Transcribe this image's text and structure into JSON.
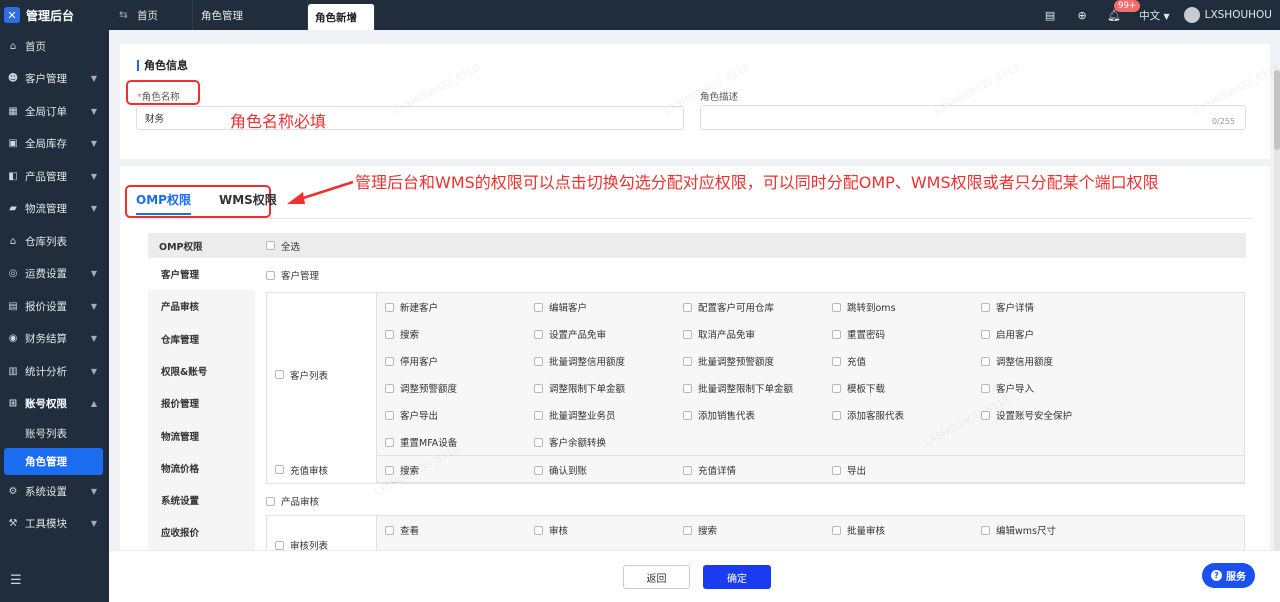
{
  "app": {
    "title": "管理后台"
  },
  "sidebar": {
    "items": [
      {
        "label": "首页",
        "icon": "home-icon",
        "chevron": false
      },
      {
        "label": "客户管理",
        "icon": "users-icon",
        "chevron": true
      },
      {
        "label": "全局订单",
        "icon": "order-icon",
        "chevron": true
      },
      {
        "label": "全局库存",
        "icon": "stock-icon",
        "chevron": true
      },
      {
        "label": "产品管理",
        "icon": "product-icon",
        "chevron": true
      },
      {
        "label": "物流管理",
        "icon": "truck-icon",
        "chevron": true
      },
      {
        "label": "仓库列表",
        "icon": "warehouse-icon",
        "chevron": false
      },
      {
        "label": "运费设置",
        "icon": "freight-icon",
        "chevron": true
      },
      {
        "label": "报价设置",
        "icon": "quote-icon",
        "chevron": true
      },
      {
        "label": "财务结算",
        "icon": "finance-icon",
        "chevron": true
      },
      {
        "label": "统计分析",
        "icon": "chart-icon",
        "chevron": true
      },
      {
        "label": "账号权限",
        "icon": "org-icon",
        "chevron": true,
        "open": true
      }
    ],
    "subitems": [
      {
        "label": "账号列表",
        "active": false
      },
      {
        "label": "角色管理",
        "active": true
      }
    ],
    "items_after": [
      {
        "label": "系统设置",
        "icon": "settings-icon",
        "chevron": true
      },
      {
        "label": "工具模块",
        "icon": "tool-icon",
        "chevron": true
      }
    ]
  },
  "tabs": [
    {
      "label": "首页"
    },
    {
      "label": "角色管理"
    },
    {
      "label": "角色新增",
      "active": true
    }
  ],
  "topbar": {
    "notification_count": "99+",
    "language": "中文",
    "username": "LXSHOUHOU"
  },
  "role_info": {
    "section_title": "角色信息",
    "name_label": "角色名称",
    "name_required_mark": "*",
    "name_value": "财务",
    "desc_label": "角色描述",
    "desc_counter": "0/255"
  },
  "annotations": {
    "name_note": "角色名称必填",
    "tabs_note": "管理后台和WMS的权限可以点击切换勾选分配对应权限，可以同时分配OMP、WMS权限或者只分配某个端口权限"
  },
  "perm_tabs": [
    {
      "label": "OMP权限",
      "active": true
    },
    {
      "label": "WMS权限",
      "active": false
    }
  ],
  "perm": {
    "head_label": "OMP权限",
    "select_all": "全选",
    "categories": [
      "客户管理",
      "产品审核",
      "仓库管理",
      "权限&账号",
      "报价管理",
      "物流管理",
      "物流价格",
      "系统设置",
      "应收报价"
    ],
    "group1_title": "客户管理",
    "group1_rows": [
      {
        "label": "客户列表",
        "items": [
          [
            "新建客户",
            "编辑客户",
            "配置客户可用仓库",
            "跳转到oms",
            "客户详情"
          ],
          [
            "搜索",
            "设置产品免审",
            "取消产品免审",
            "重置密码",
            "启用客户"
          ],
          [
            "停用客户",
            "批量调整信用额度",
            "批量调整预警额度",
            "充值",
            "调整信用额度"
          ],
          [
            "调整预警额度",
            "调整限制下单金额",
            "批量调整限制下单金额",
            "模板下载",
            "客户导入"
          ],
          [
            "客户导出",
            "批量调整业务员",
            "添加销售代表",
            "添加客服代表",
            "设置账号安全保护"
          ],
          [
            "重置MFA设备",
            "客户余额转换"
          ]
        ]
      },
      {
        "label": "充值审核",
        "items": [
          [
            "搜索",
            "确认到账",
            "充值详情",
            "导出"
          ]
        ]
      }
    ],
    "group2_title": "产品审核",
    "group2_rows": [
      {
        "label": "审核列表",
        "items": [
          [
            "查看",
            "审核",
            "搜索",
            "批量审核",
            "编辑wms尺寸"
          ]
        ]
      }
    ]
  },
  "footer": {
    "back_label": "返回",
    "confirm_label": "确定",
    "service_label": "服务"
  },
  "watermark": "LXSHOUHOU_8118",
  "colors": {
    "sidebar_bg": "#1f2d3d",
    "accent": "#1a6cf0",
    "annotation": "#ee3030",
    "confirm": "#1a3bf0"
  }
}
